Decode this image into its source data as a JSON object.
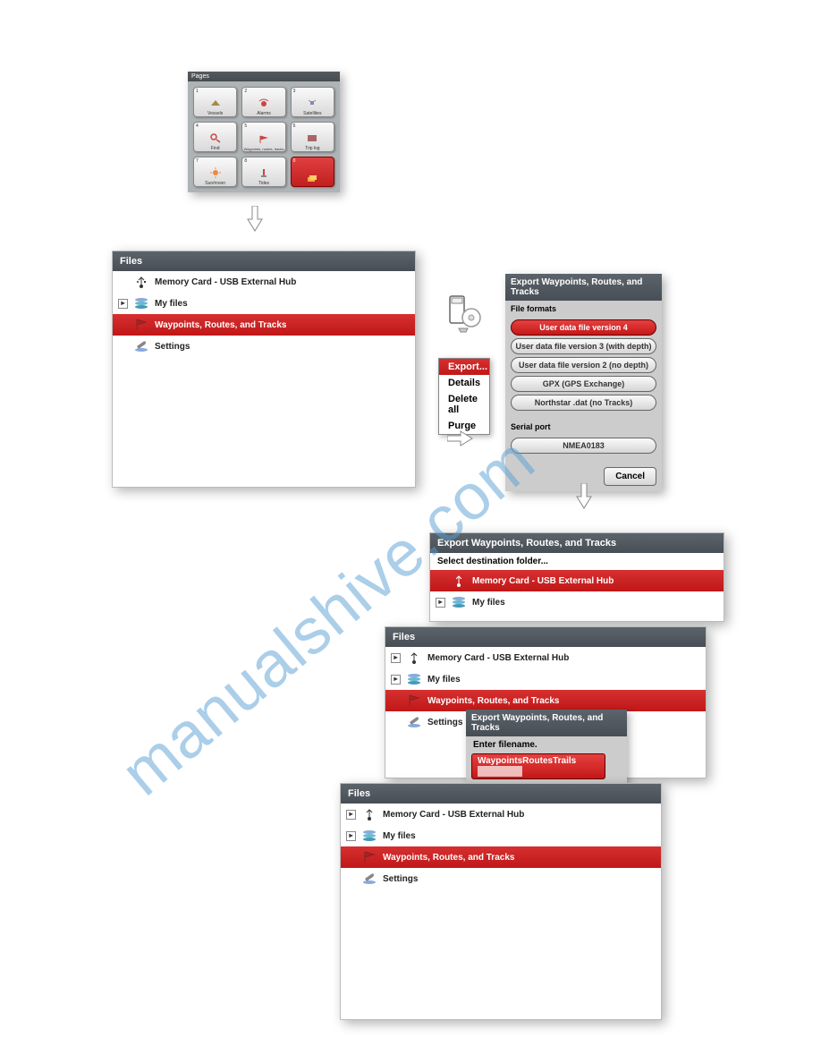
{
  "watermark": "manualshive.com",
  "pages_panel": {
    "title": "Pages",
    "items": [
      {
        "num": "1",
        "label": "Vessels"
      },
      {
        "num": "2",
        "label": "Alarms"
      },
      {
        "num": "3",
        "label": "Satellites"
      },
      {
        "num": "4",
        "label": "Find"
      },
      {
        "num": "5",
        "label": "Waypoints, routes, tracks"
      },
      {
        "num": "6",
        "label": "Trip log"
      },
      {
        "num": "7",
        "label": "Sun/moon"
      },
      {
        "num": "8",
        "label": "Tides"
      },
      {
        "num": "0",
        "label": ""
      }
    ]
  },
  "files_panel_1": {
    "title": "Files",
    "rows": [
      {
        "label": "Memory Card - USB External Hub",
        "icon": "usb"
      },
      {
        "label": "My files",
        "icon": "disks",
        "expand": true
      },
      {
        "label": "Waypoints, Routes, and Tracks",
        "icon": "flag",
        "selected": true
      },
      {
        "label": "Settings",
        "icon": "wrench"
      }
    ]
  },
  "ctx_menu": {
    "items": [
      "Export...",
      "Details",
      "Delete all",
      "Purge"
    ]
  },
  "export_formats": {
    "title": "Export Waypoints, Routes, and Tracks",
    "section1": "File formats",
    "options": [
      "User data file version 4",
      "User data file version 3 (with depth)",
      "User data file version 2 (no depth)",
      "GPX (GPS Exchange)",
      "Northstar .dat (no Tracks)"
    ],
    "section2": "Serial port",
    "serial": "NMEA0183",
    "cancel": "Cancel"
  },
  "dest_panel": {
    "title": "Export Waypoints, Routes, and Tracks",
    "prompt": "Select destination folder...",
    "rows": [
      {
        "label": "Memory Card - USB External Hub",
        "icon": "usb",
        "selected": true
      },
      {
        "label": "My files",
        "icon": "disks",
        "expand": true
      }
    ]
  },
  "files_panel_2": {
    "title": "Files",
    "rows": [
      {
        "label": "Memory Card - USB External Hub",
        "icon": "usb",
        "expand": true
      },
      {
        "label": "My files",
        "icon": "disks",
        "expand": true
      },
      {
        "label": "Waypoints, Routes, and Tracks",
        "icon": "flag",
        "selected": true
      },
      {
        "label": "Settings",
        "icon": "wrench"
      }
    ],
    "subpanel": {
      "title": "Export Waypoints, Routes, and Tracks",
      "prompt": "Enter filename.",
      "value": "WaypointsRoutesTrails"
    }
  },
  "files_panel_3": {
    "title": "Files",
    "rows": [
      {
        "label": "Memory Card - USB External Hub",
        "icon": "usb",
        "expand": true
      },
      {
        "label": "My files",
        "icon": "disks",
        "expand": true
      },
      {
        "label": "Waypoints, Routes, and Tracks",
        "icon": "flag",
        "selected": true
      },
      {
        "label": "Settings",
        "icon": "wrench"
      }
    ]
  }
}
